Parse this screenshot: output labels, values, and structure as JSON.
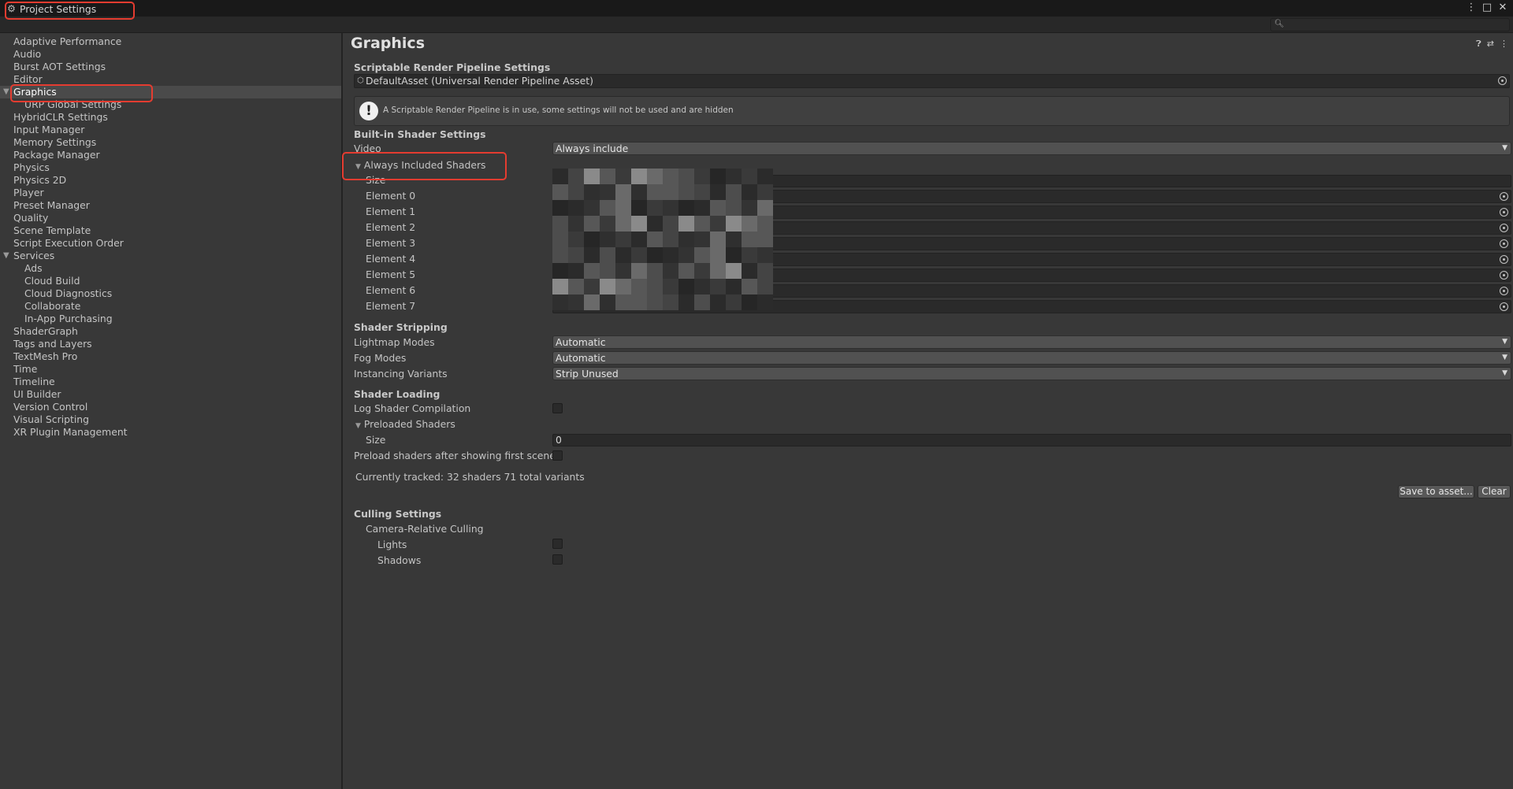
{
  "window": {
    "title": "Project Settings",
    "controls": [
      "⋮",
      "□",
      "✕"
    ]
  },
  "search": {
    "placeholder": ""
  },
  "sidebar": {
    "items": [
      {
        "label": "Adaptive Performance"
      },
      {
        "label": "Audio"
      },
      {
        "label": "Burst AOT Settings"
      },
      {
        "label": "Editor"
      },
      {
        "label": "Graphics",
        "selected": true,
        "expanded": true
      },
      {
        "label": "URP Global Settings",
        "child": true
      },
      {
        "label": "HybridCLR Settings"
      },
      {
        "label": "Input Manager"
      },
      {
        "label": "Memory Settings"
      },
      {
        "label": "Package Manager"
      },
      {
        "label": "Physics"
      },
      {
        "label": "Physics 2D"
      },
      {
        "label": "Player"
      },
      {
        "label": "Preset Manager"
      },
      {
        "label": "Quality"
      },
      {
        "label": "Scene Template"
      },
      {
        "label": "Script Execution Order"
      },
      {
        "label": "Services",
        "expanded": true
      },
      {
        "label": "Ads",
        "child": true
      },
      {
        "label": "Cloud Build",
        "child": true
      },
      {
        "label": "Cloud Diagnostics",
        "child": true
      },
      {
        "label": "Collaborate",
        "child": true
      },
      {
        "label": "In-App Purchasing",
        "child": true
      },
      {
        "label": "ShaderGraph"
      },
      {
        "label": "Tags and Layers"
      },
      {
        "label": "TextMesh Pro"
      },
      {
        "label": "Time"
      },
      {
        "label": "Timeline"
      },
      {
        "label": "UI Builder"
      },
      {
        "label": "Version Control"
      },
      {
        "label": "Visual Scripting"
      },
      {
        "label": "XR Plugin Management"
      }
    ]
  },
  "graphics": {
    "title": "Graphics",
    "header_icons": [
      "help-icon",
      "preset-icon",
      "more-icon"
    ],
    "srp_section": "Scriptable Render Pipeline Settings",
    "srp_asset": "DefaultAsset (Universal Render Pipeline Asset)",
    "srp_help": "A Scriptable Render Pipeline is in use, some settings will not be used and are hidden",
    "builtin_section": "Built-in Shader Settings",
    "video_label": "Video",
    "video_value": "Always include",
    "always_included_label": "Always Included Shaders",
    "size_label": "Size",
    "elements": [
      "Element 0",
      "Element 1",
      "Element 2",
      "Element 3",
      "Element 4",
      "Element 5",
      "Element 6",
      "Element 7"
    ],
    "stripping_section": "Shader Stripping",
    "lightmap_label": "Lightmap Modes",
    "lightmap_value": "Automatic",
    "fog_label": "Fog Modes",
    "fog_value": "Automatic",
    "instancing_label": "Instancing Variants",
    "instancing_value": "Strip Unused",
    "loading_section": "Shader Loading",
    "log_shader_label": "Log Shader Compilation",
    "log_shader_checked": false,
    "preloaded_label": "Preloaded Shaders",
    "preloaded_size_label": "Size",
    "preloaded_size_value": "0",
    "preload_after_label": "Preload shaders after showing first scene",
    "preload_after_checked": false,
    "tracked_text": "Currently tracked: 32 shaders 71 total variants",
    "save_button": "Save to asset...",
    "clear_button": "Clear",
    "culling_section": "Culling Settings",
    "camera_culling_label": "Camera-Relative Culling",
    "lights_label": "Lights",
    "lights_checked": false,
    "shadows_label": "Shadows",
    "shadows_checked": false
  },
  "colors": {
    "background": "#383838",
    "selection": "#4a4a4a",
    "highlight": "#e53c30"
  }
}
